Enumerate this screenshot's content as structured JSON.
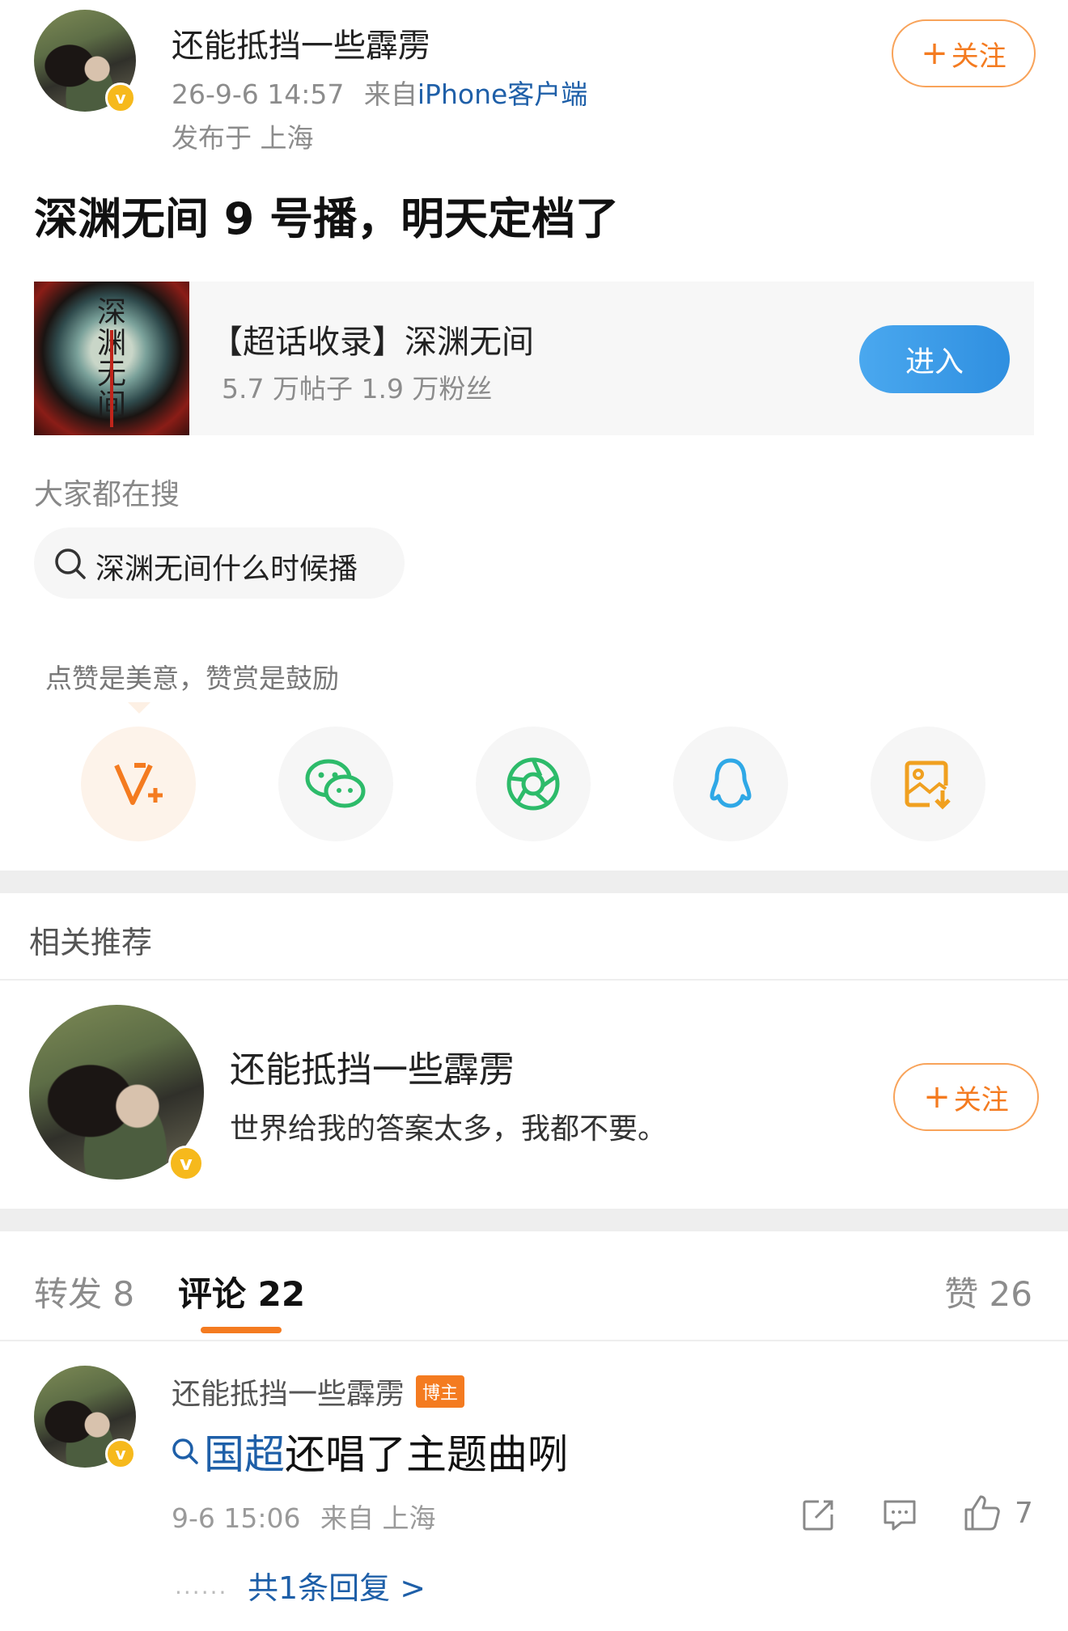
{
  "post": {
    "author": "还能抵挡一些霹雳",
    "time": "26-9-6 14:57",
    "from_label": "来自",
    "device": "iPhone客户端",
    "location": "发布于 上海",
    "follow_label": "关注",
    "content": "深渊无间 9 号播，明天定档了"
  },
  "super_topic": {
    "title": "【超话收录】深渊无间",
    "stats": "5.7 万帖子 1.9 万粉丝",
    "enter_label": "进入",
    "cover_text": "深渊无间"
  },
  "search": {
    "heading": "大家都在搜",
    "query": "深渊无间什么时候播"
  },
  "reward": {
    "tip": "点赞是美意，赞赏是鼓励"
  },
  "share_icons": [
    "reward-v-icon",
    "wechat-icon",
    "moments-icon",
    "qq-icon",
    "save-image-icon"
  ],
  "related": {
    "heading": "相关推荐",
    "name": "还能抵挡一些霹雳",
    "bio": "世界给我的答案太多，我都不要。",
    "follow_label": "关注"
  },
  "tabs": {
    "repost": "转发 8",
    "comments": "评论 22",
    "likes": "赞 26"
  },
  "comment": {
    "author": "还能抵挡一些霹雳",
    "badge": "博主",
    "link_text": "国超",
    "text": "还唱了主题曲咧",
    "time": "9-6 15:06",
    "from": "来自 上海",
    "like_count": "7",
    "replies": "共1条回复 >"
  },
  "colors": {
    "accent_orange": "#f47b20",
    "link_blue": "#1e5fa8",
    "enter_button": "#3a9be8",
    "verified_badge": "#f6b91c"
  }
}
